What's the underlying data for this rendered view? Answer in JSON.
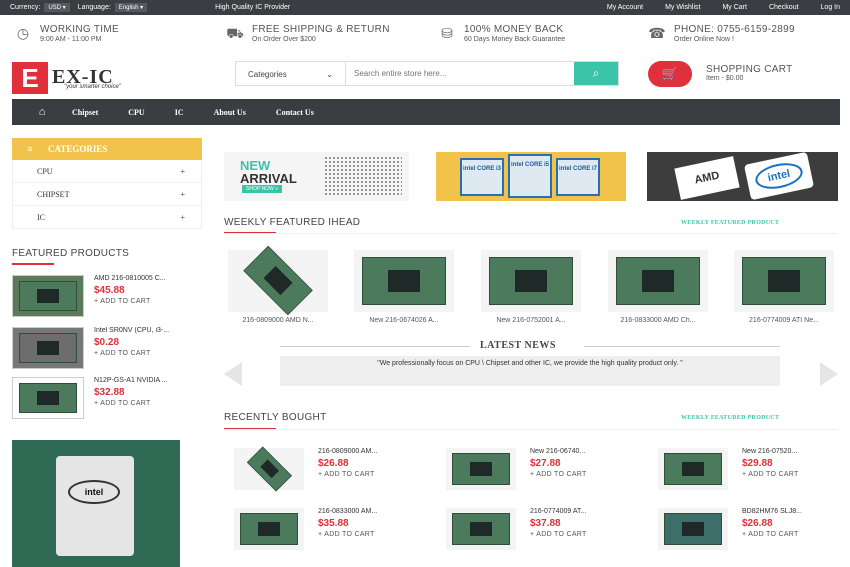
{
  "topbar": {
    "currency_label": "Currency:",
    "currency_value": "USD",
    "language_label": "Language:",
    "language_value": "English",
    "tagline": "High Quality IC Provider",
    "links": [
      "My Account",
      "My Wishlist",
      "My Cart",
      "Checkout",
      "Log In"
    ]
  },
  "info": [
    {
      "icon": "clock-icon",
      "glyph": "◷",
      "title": "WORKING TIME",
      "sub": "9:00 AM - 11:00 PM"
    },
    {
      "icon": "truck-icon",
      "glyph": "⛟",
      "title": "FREE SHIPPING & RETURN",
      "sub": "On Order Over $200"
    },
    {
      "icon": "money-bag-icon",
      "glyph": "⛁",
      "title": "100% MONEY BACK",
      "sub": "60 Days Money Back Guarantee"
    },
    {
      "icon": "phone-icon",
      "glyph": "☎",
      "title": "PHONE: 0755-6159-2899",
      "sub": "Order Online Now !"
    }
  ],
  "logo": {
    "letter": "E",
    "text": "EX-IC",
    "slogan": "\"your smarter choice\""
  },
  "search": {
    "category": "Categories",
    "placeholder": "Search entire store here..."
  },
  "cart": {
    "title": "SHOPPING CART",
    "sub": "Item - $0.00"
  },
  "nav": {
    "items": [
      "Chipset",
      "CPU",
      "IC",
      "About Us",
      "Contact Us"
    ]
  },
  "categories": {
    "title": "CATEGORIES",
    "items": [
      "CPU",
      "CHIPSET",
      "IC"
    ]
  },
  "featured": {
    "title": "FEATURED PRODUCTS",
    "items": [
      {
        "name": "AMD 216-0810005 C...",
        "price": "$45.88",
        "cta": "+ ADD TO CART"
      },
      {
        "name": "Intel SR0NV (CPU, i3-...",
        "price": "$0.28",
        "cta": "+ ADD TO CART"
      },
      {
        "name": "N12P-GS-A1 NVIDIA ...",
        "price": "$32.88",
        "cta": "+ ADD TO CART"
      }
    ]
  },
  "banners": {
    "new": "NEW",
    "arrival": "ARRIVAL",
    "shop": "SHOP NOW »",
    "intel_boxes": [
      "intel CORE i3",
      "intel CORE i5",
      "intel CORE i7"
    ],
    "amd": "AMD",
    "intel": "intel"
  },
  "weekly": {
    "title": "WEEKLY FEATURED IHEAD",
    "link": "WEEKLY FEATURED PRODUCT",
    "items": [
      "216-0809000 AMD N...",
      "New 216-0674026 A...",
      "New 216-0752001 A...",
      "216-0833000 AMD Ch...",
      "216-0774009 ATI Ne..."
    ]
  },
  "news": {
    "title": "LATEST NEWS",
    "text": "\"We professionally focus on CPU \\ Chipset and other IC, we provide the high quality product only. \""
  },
  "recent": {
    "title": "RECENTLY BOUGHT",
    "link": "WEEKLY FEATURED PRODUCT",
    "items": [
      {
        "name": "216-0809000 AM...",
        "price": "$26.88",
        "cta": "+ ADD TO CART"
      },
      {
        "name": "New 216-06740...",
        "price": "$27.88",
        "cta": "+ ADD TO CART"
      },
      {
        "name": "New 216-07520...",
        "price": "$29.88",
        "cta": "+ ADD TO CART"
      },
      {
        "name": "216-0833000 AM...",
        "price": "$35.88",
        "cta": "+ ADD TO CART"
      },
      {
        "name": "216-0774009 AT...",
        "price": "$37.88",
        "cta": "+ ADD TO CART"
      },
      {
        "name": "BD82HM76 SLJ8...",
        "price": "$26.88",
        "cta": "+ ADD TO CART"
      }
    ]
  },
  "colors": {
    "accent": "#e0303b",
    "teal": "#3cc4a8",
    "yellow": "#f2c34a",
    "dark": "#3a3d42"
  }
}
